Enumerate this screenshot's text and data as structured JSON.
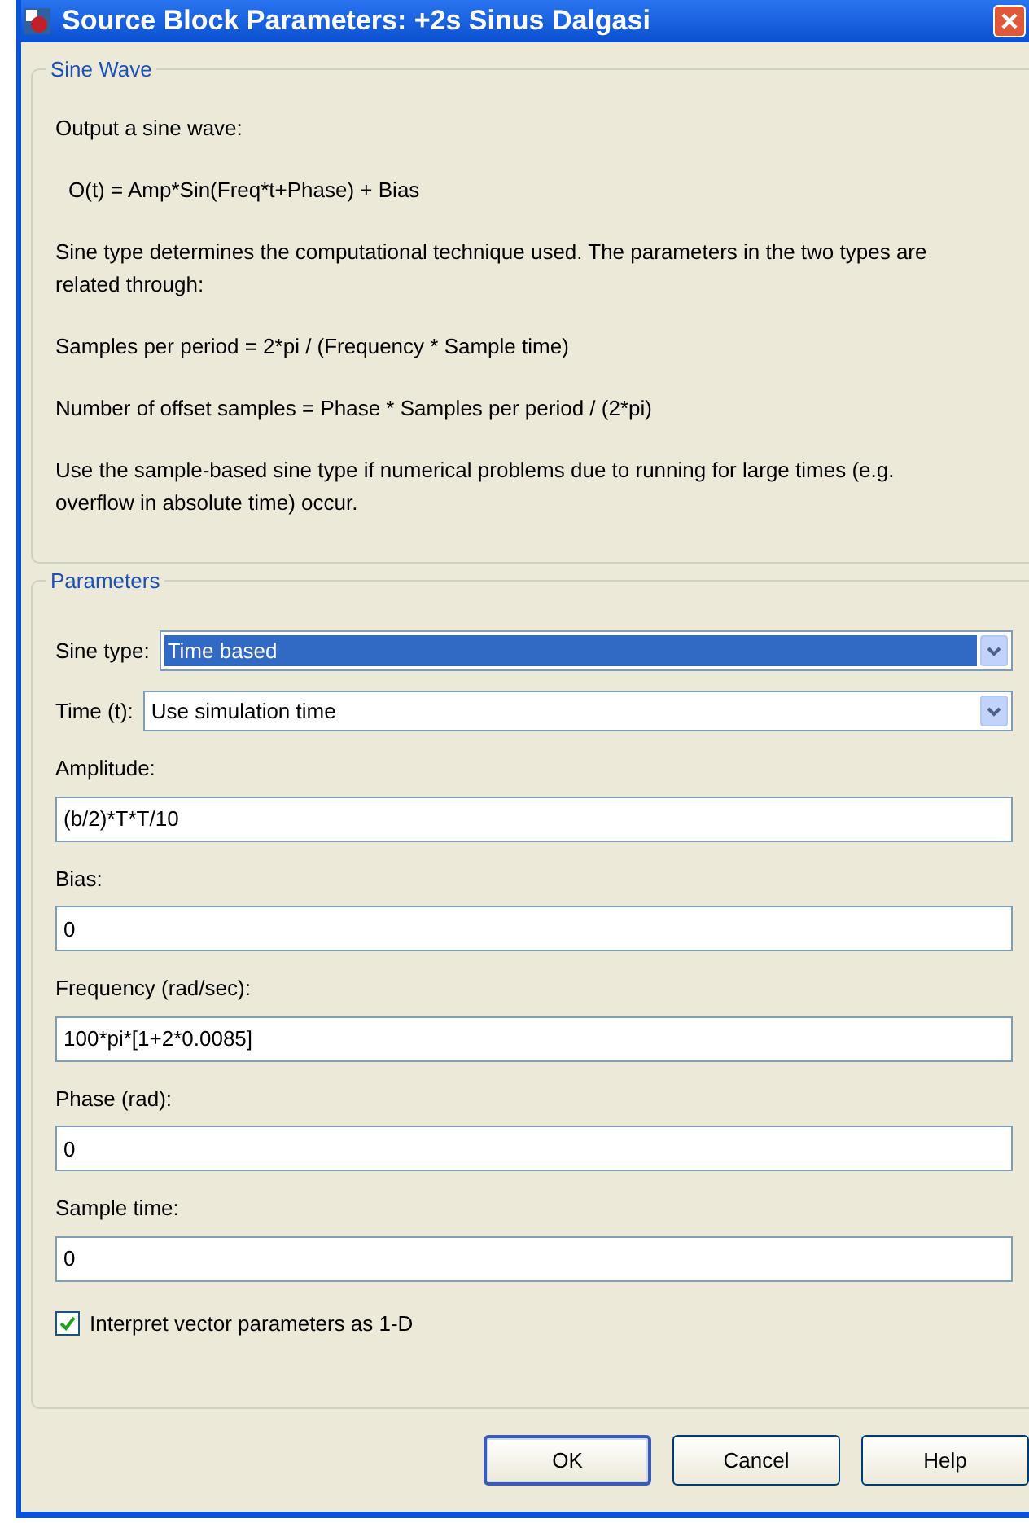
{
  "window": {
    "title": "Source Block Parameters: +2s Sinus Dalgasi"
  },
  "description": {
    "legend": "Sine Wave",
    "paragraphs": [
      {
        "text": "Output a sine wave:",
        "indent": false
      },
      {
        "text": "O(t) = Amp*Sin(Freq*t+Phase) + Bias",
        "indent": true
      },
      {
        "text": "Sine type determines the computational technique used. The parameters in the two types are related through:",
        "indent": false
      },
      {
        "text": "Samples per period = 2*pi / (Frequency * Sample time)",
        "indent": false
      },
      {
        "text": "Number of offset samples = Phase * Samples per period / (2*pi)",
        "indent": false
      },
      {
        "text": "Use the sample-based sine type if numerical problems due to running for large times (e.g. overflow in absolute time) occur.",
        "indent": false
      }
    ]
  },
  "parameters": {
    "legend": "Parameters",
    "dropdowns": [
      {
        "label": "Sine type:",
        "value": "Time based",
        "focused": true
      },
      {
        "label": "Time (t):",
        "value": "Use simulation time",
        "focused": false
      }
    ],
    "fields": [
      {
        "label": "Amplitude:",
        "value": "(b/2)*T*T/10"
      },
      {
        "label": "Bias:",
        "value": "0"
      },
      {
        "label": "Frequency (rad/sec):",
        "value": "100*pi*[1+2*0.0085]"
      },
      {
        "label": "Phase (rad):",
        "value": "0"
      },
      {
        "label": "Sample time:",
        "value": "0"
      }
    ],
    "checkbox": {
      "label": "Interpret vector parameters as 1-D",
      "checked": true
    }
  },
  "buttons": [
    {
      "label": "OK",
      "default": true
    },
    {
      "label": "Cancel",
      "default": false
    },
    {
      "label": "Help",
      "default": false
    }
  ]
}
